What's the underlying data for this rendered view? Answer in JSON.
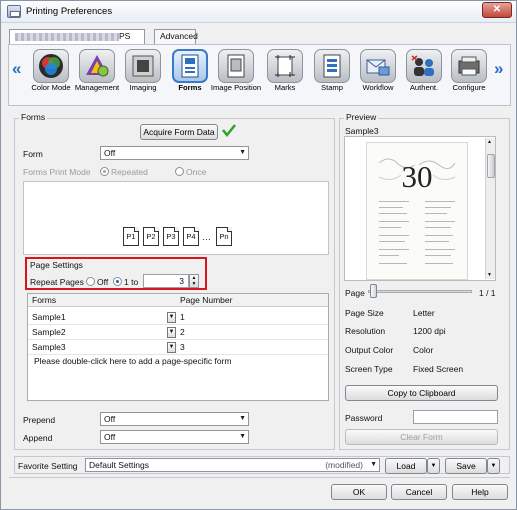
{
  "window": {
    "title": "Printing Preferences",
    "close_label": "✕"
  },
  "tabs": [
    {
      "label_suffix": "PS",
      "active": true
    },
    {
      "label": "Advanced",
      "active": false
    }
  ],
  "toolbar": {
    "items": [
      {
        "label": "Color Mode",
        "icon": "color-mode-icon"
      },
      {
        "label": "Management",
        "icon": "management-icon"
      },
      {
        "label": "Imaging",
        "icon": "imaging-icon"
      },
      {
        "label": "Forms",
        "icon": "forms-icon",
        "selected": true
      },
      {
        "label": "Image Position",
        "icon": "image-position-icon"
      },
      {
        "label": "Marks",
        "icon": "marks-icon"
      },
      {
        "label": "Stamp",
        "icon": "stamp-icon"
      },
      {
        "label": "Workflow",
        "icon": "workflow-icon"
      },
      {
        "label": "Authent.",
        "icon": "authentication-icon"
      },
      {
        "label": "Configure",
        "icon": "configure-icon"
      }
    ],
    "prev_arrow": "«",
    "next_arrow": "»"
  },
  "forms": {
    "section_label": "Forms",
    "acquire_button": "Acquire Form Data",
    "form_label": "Form",
    "form_value": "Off",
    "print_mode_label": "Forms Print Mode",
    "mode_repeated": "Repeated",
    "mode_once": "Once",
    "pages": [
      "P1",
      "P2",
      "P3",
      "P4",
      "…",
      "Pn"
    ]
  },
  "page_settings": {
    "group_label": "Page Settings",
    "repeat_label": "Repeat Pages",
    "off_label": "Off",
    "one_to_label": "1 to",
    "repeat_value": "3"
  },
  "grid": {
    "col_forms": "Forms",
    "col_page": "Page Number",
    "rows": [
      {
        "form": "Sample1",
        "page": "1"
      },
      {
        "form": "Sample2",
        "page": "2"
      },
      {
        "form": "Sample3",
        "page": "3"
      }
    ],
    "hint": "Please double-click here to add a page-specific form"
  },
  "prepend": {
    "label": "Prepend",
    "value": "Off"
  },
  "append": {
    "label": "Append",
    "value": "Off"
  },
  "preview": {
    "label": "Preview",
    "form_name": "Sample3",
    "big_number": "30",
    "page_label": "Page",
    "page_count": "1 / 1",
    "page_size_label": "Page Size",
    "page_size_value": "Letter",
    "resolution_label": "Resolution",
    "resolution_value": "1200 dpi",
    "output_color_label": "Output Color",
    "output_color_value": "Color",
    "screen_type_label": "Screen Type",
    "screen_type_value": "Fixed Screen",
    "copy_button": "Copy to Clipboard",
    "password_label": "Password",
    "clear_form_button": "Clear Form"
  },
  "favorite": {
    "label": "Favorite Setting",
    "value": "Default Settings",
    "modified": "(modified)",
    "load_button": "Load",
    "save_button": "Save"
  },
  "footer": {
    "ok": "OK",
    "cancel": "Cancel",
    "help": "Help"
  }
}
